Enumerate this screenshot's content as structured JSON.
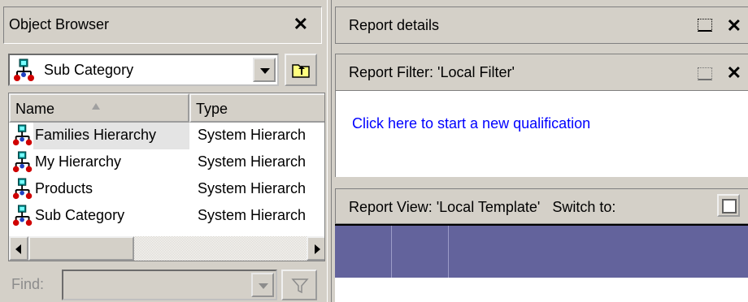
{
  "object_browser": {
    "title": "Object Browser",
    "combo_value": "Sub Category",
    "columns": {
      "name": "Name",
      "type": "Type"
    },
    "rows": [
      {
        "name": "Families Hierarchy",
        "type": "System Hierarch"
      },
      {
        "name": "My Hierarchy",
        "type": "System Hierarch"
      },
      {
        "name": "Products",
        "type": "System Hierarch"
      },
      {
        "name": "Sub Category",
        "type": "System Hierarch"
      }
    ],
    "selected_row": "Families Hierarchy",
    "find_label": "Find:",
    "find_value": "",
    "icons": {
      "hierarchy": "hierarchy-icon",
      "up_folder": "up-folder-icon",
      "filter": "funnel-filter-icon",
      "close": "close-icon"
    }
  },
  "report_details": {
    "title": "Report details"
  },
  "report_filter": {
    "title": "Report Filter: 'Local Filter'",
    "link": "Click here to start a new qualification"
  },
  "report_view": {
    "title": "Report View: 'Local Template'",
    "switch_label": "Switch to:"
  },
  "colors": {
    "link": "#0000ff",
    "grid_header": "#63639c",
    "window_bg": "#d4d0c8"
  }
}
